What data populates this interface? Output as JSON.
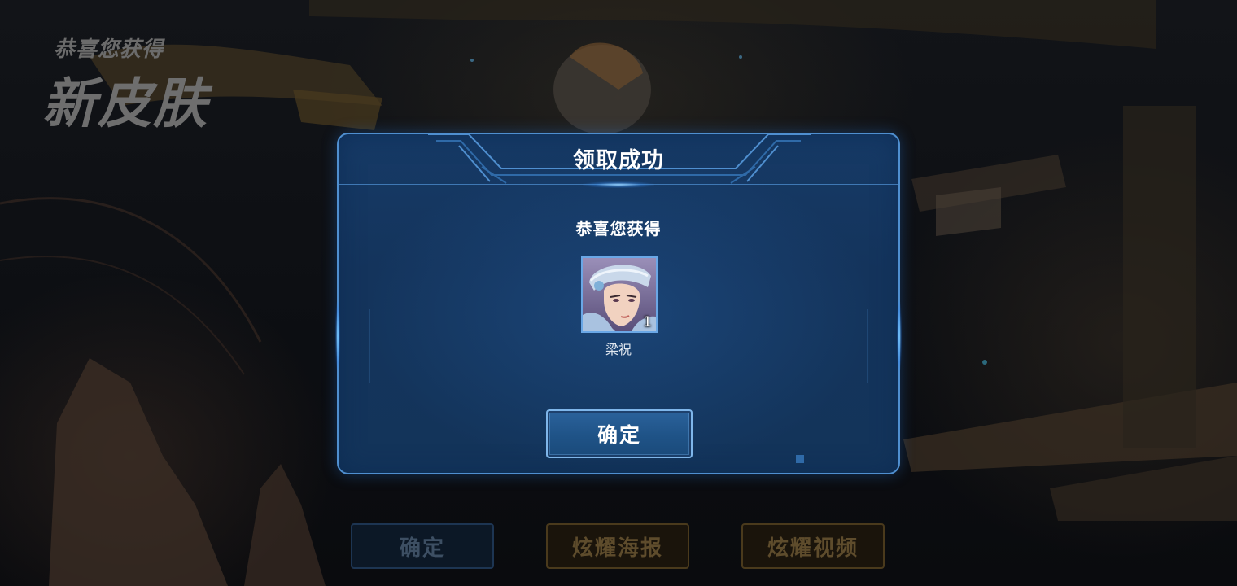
{
  "background": {
    "title_small": "恭喜您获得",
    "title_large": "新皮肤",
    "bottom_buttons": [
      {
        "label": "确定"
      },
      {
        "label": "炫耀海报"
      },
      {
        "label": "炫耀视频"
      }
    ]
  },
  "dialog": {
    "title": "领取成功",
    "subtitle": "恭喜您获得",
    "reward": {
      "name": "梁祝",
      "count": "1",
      "icon": "hero-skin-portrait-icon"
    },
    "confirm_label": "确定"
  },
  "colors": {
    "dialog_border": "#4f8fd0",
    "dialog_bg": "#14345c",
    "button_bg": "#1f5387",
    "gold_dim": "#5e4c2c"
  }
}
